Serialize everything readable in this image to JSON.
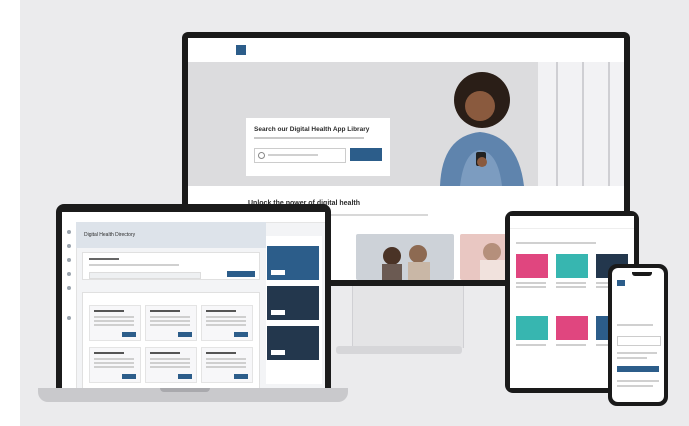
{
  "monitor": {
    "nav": {
      "links": [
        "",
        "",
        "",
        ""
      ]
    },
    "hero": {
      "title": "Search our Digital Health App Library"
    },
    "section": {
      "title": "Unlock the power of digital health"
    }
  },
  "laptop": {
    "page_title": "Digital Health Directory",
    "panel_title": ""
  },
  "tablet": {
    "title": ""
  },
  "phone": {
    "headline": ""
  },
  "colors": {
    "primary": "#2c5d8a",
    "dark": "#23374d",
    "accent_pink": "#e0467f",
    "teal": "#37b6b0",
    "backdrop": "#ebebed"
  }
}
